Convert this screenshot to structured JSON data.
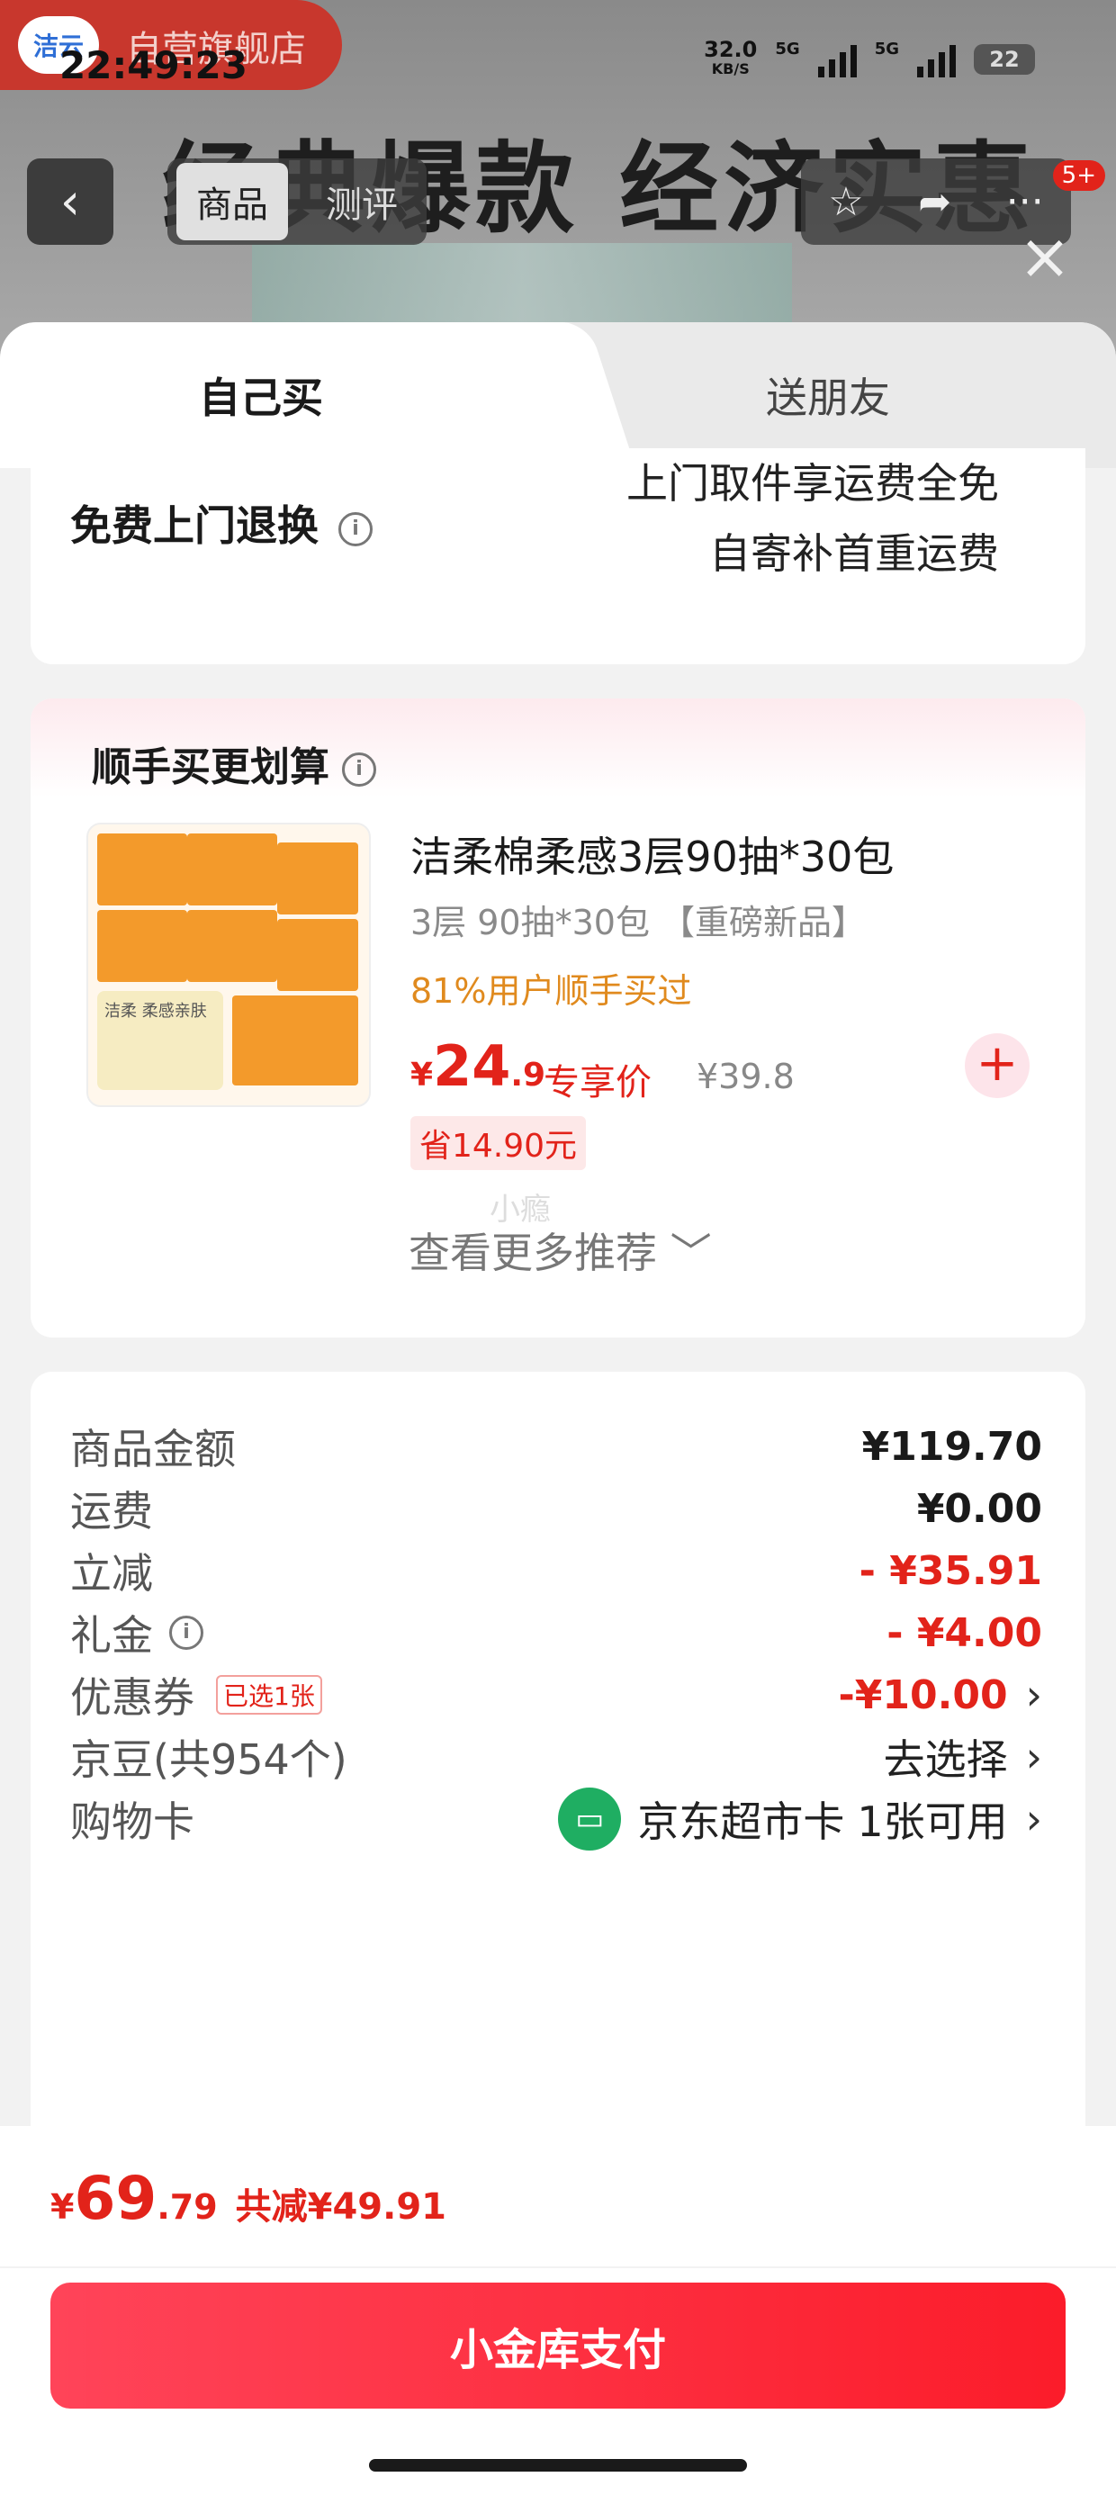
{
  "status_bar": {
    "time": "22:49:23",
    "net_speed": "32.0",
    "net_unit": "KB/S",
    "signal_1": "5G",
    "signal_2": "5G",
    "battery": "22"
  },
  "store": {
    "logo": "洁云",
    "name": "自营旗舰店"
  },
  "banner": {
    "text": "经典爆款  经济实惠"
  },
  "nav": {
    "tab_product": "商品",
    "tab_review": "测评",
    "badge": "5+"
  },
  "sheet_tabs": {
    "self": "自己买",
    "gift": "送朋友"
  },
  "return_service": {
    "title": "免费上门退换",
    "line1": "上门取件享运费全免",
    "line2": "自寄补首重运费"
  },
  "recommend": {
    "title": "顺手买更划算",
    "product_name": "洁柔棉柔感3层90抽*30包",
    "spec": "3层 90抽*30包 【重磅新品】",
    "bought": "81%用户顺手买过",
    "price_symbol": "¥",
    "price_int": "24",
    "price_dec": ".9",
    "price_label": "专享价",
    "original_price": "¥39.8",
    "save": "省14.90元",
    "watermark": "小瘾",
    "more": "查看更多推荐 ﹀",
    "image_text": "洁柔 柔感亲肤"
  },
  "summary": {
    "rows": [
      {
        "label": "商品金额",
        "value": "¥119.70"
      },
      {
        "label": "运费",
        "value": "¥0.00"
      },
      {
        "label": "立减",
        "value": "- ¥35.91"
      },
      {
        "label": "礼金",
        "value": "- ¥4.00"
      },
      {
        "label": "优惠券",
        "tag": "已选1张",
        "value": "-¥10.00"
      },
      {
        "label": "京豆(共954个)",
        "value": "去选择"
      },
      {
        "label": "购物卡",
        "value": "京东超市卡",
        "extra": "1张可用"
      }
    ]
  },
  "bottom": {
    "price_symbol": "¥",
    "price_int": "69",
    "price_dec": ".79",
    "reduce": "共减¥49.91",
    "pay_button": "小金库支付"
  },
  "colors": {
    "accent": "#e2231a",
    "pay_gradient_start": "#ff4459",
    "pay_gradient_end": "#fb1c2a",
    "orange": "#e08a1e"
  }
}
